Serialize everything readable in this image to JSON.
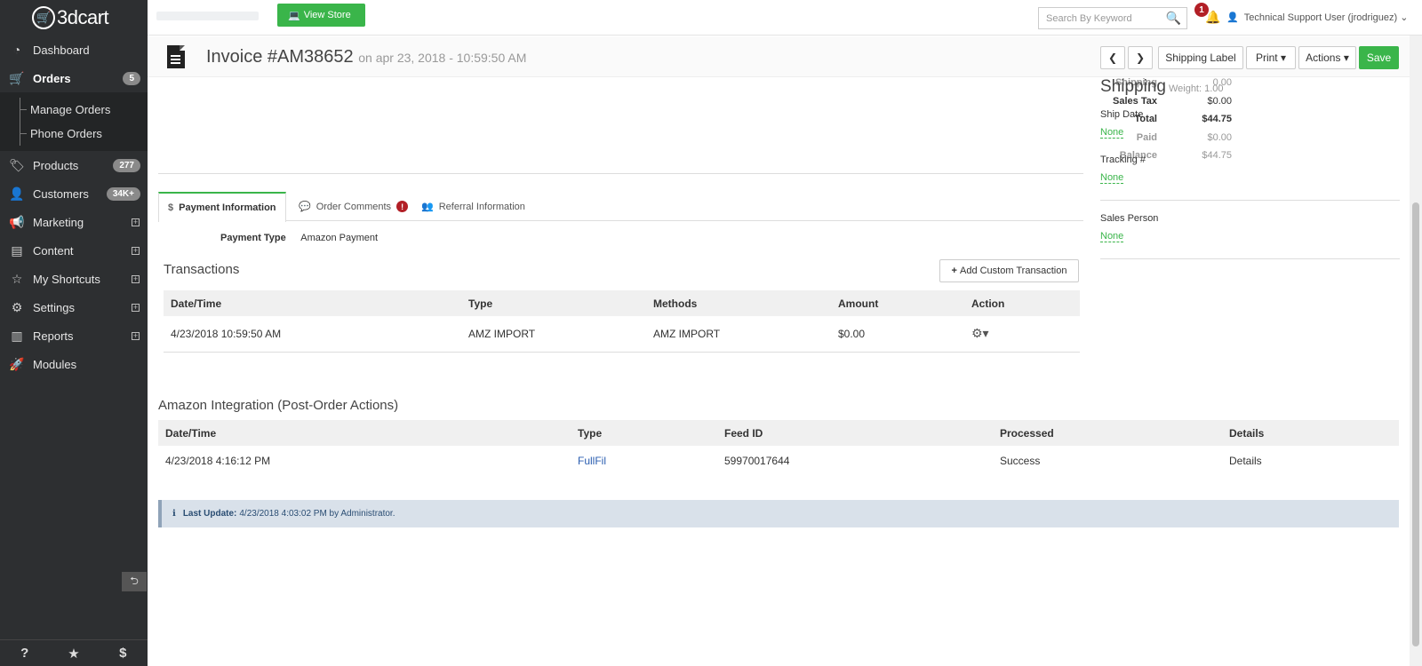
{
  "sidebar": {
    "logo": "3dcart",
    "items": [
      {
        "label": "Dashboard",
        "icon": "dashboard-icon"
      },
      {
        "label": "Orders",
        "icon": "cart-icon",
        "badge": "5"
      },
      {
        "label": "Products",
        "icon": "tags-icon",
        "badge": "277"
      },
      {
        "label": "Customers",
        "icon": "user-icon",
        "badge": "34K+"
      },
      {
        "label": "Marketing",
        "icon": "bullhorn-icon"
      },
      {
        "label": "Content",
        "icon": "file-icon"
      },
      {
        "label": "My Shortcuts",
        "icon": "star-icon"
      },
      {
        "label": "Settings",
        "icon": "gears-icon"
      },
      {
        "label": "Reports",
        "icon": "chart-icon"
      },
      {
        "label": "Modules",
        "icon": "rocket-icon"
      }
    ],
    "orders_submenu": [
      "Manage Orders",
      "Phone Orders"
    ],
    "footer": [
      "?",
      "★",
      "$"
    ]
  },
  "topbar": {
    "view_store": "View Store",
    "search_placeholder": "Search By Keyword",
    "notification_count": "1",
    "user": "Technical Support User (jrodriguez)"
  },
  "invoice": {
    "title": "Invoice #AM38652",
    "date": "on apr 23, 2018 - 10:59:50 AM",
    "buttons": {
      "shipping_label": "Shipping Label",
      "print": "Print",
      "actions": "Actions",
      "save": "Save"
    }
  },
  "totals": [
    {
      "label": "Shipping",
      "value": "0.00"
    },
    {
      "label": "Sales Tax",
      "value": "$0.00"
    },
    {
      "label": "Total",
      "value": "$44.75"
    },
    {
      "label": "Paid",
      "value": "$0.00"
    },
    {
      "label": "Balance",
      "value": "$44.75"
    }
  ],
  "tabs": [
    "Payment Information",
    "Order Comments",
    "Referral Information"
  ],
  "payment": {
    "label": "Payment Type",
    "value": "Amazon Payment"
  },
  "transactions": {
    "title": "Transactions",
    "add_button": "Add Custom Transaction",
    "headers": [
      "Date/Time",
      "Type",
      "Methods",
      "Amount",
      "Action"
    ],
    "rows": [
      [
        "4/23/2018 10:59:50 AM",
        "AMZ IMPORT",
        "AMZ IMPORT",
        "$0.00"
      ]
    ]
  },
  "amazon": {
    "title": "Amazon Integration (Post-Order Actions)",
    "headers": [
      "Date/Time",
      "Type",
      "Feed ID",
      "Processed",
      "Details"
    ],
    "rows": [
      [
        "4/23/2018 4:16:12 PM",
        "FullFil",
        "59970017644",
        "Success",
        "Details"
      ]
    ]
  },
  "last_update": {
    "label": "Last Update:",
    "text": "4/23/2018 4:03:02 PM by Administrator."
  },
  "shipping": {
    "title": "Shipping",
    "weight": "Weight: 1.00",
    "ship_date_label": "Ship Date",
    "ship_date": "None",
    "tracking_label": "Tracking #",
    "tracking": "None",
    "sales_person_label": "Sales Person",
    "sales_person": "None"
  },
  "colors": {
    "accent": "#3ab54a",
    "sidebar": "#2d2f31",
    "alert": "#b21f26"
  }
}
